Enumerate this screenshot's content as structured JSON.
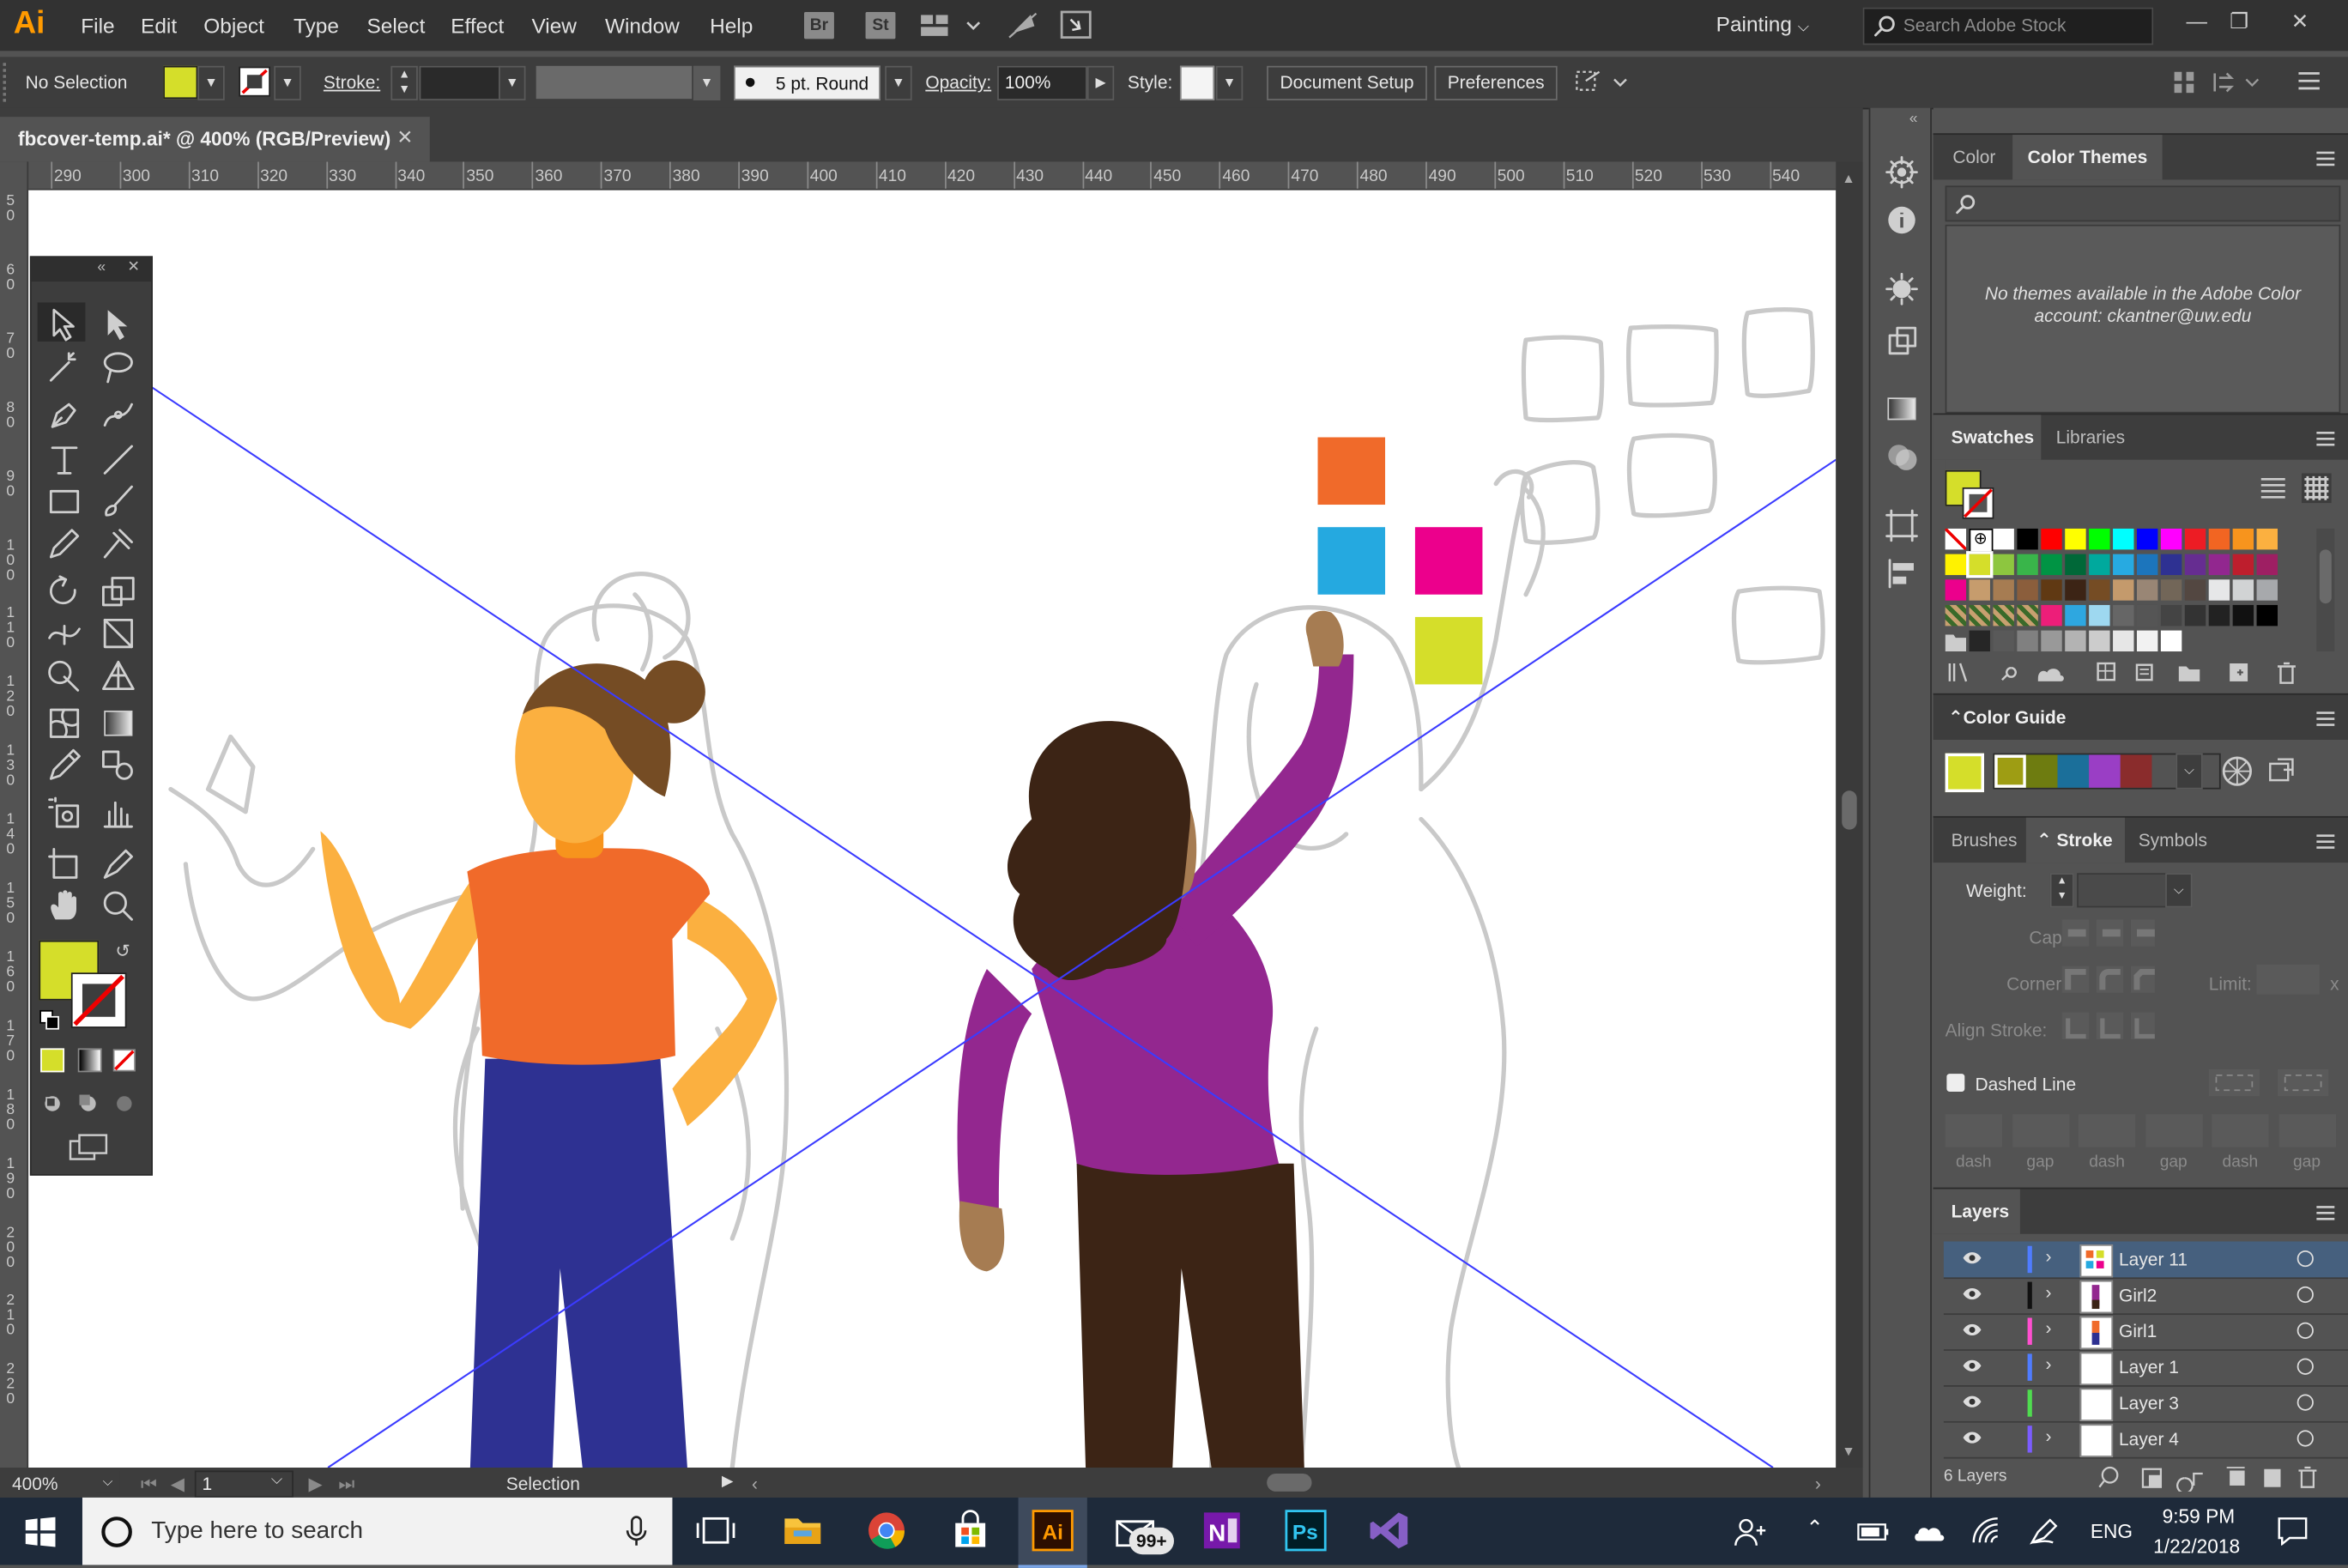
{
  "app": {
    "logo": "Ai",
    "menu": [
      "File",
      "Edit",
      "Object",
      "Type",
      "Select",
      "Effect",
      "View",
      "Window",
      "Help"
    ],
    "bridge_label": "Br",
    "stock_label": "St",
    "workspace": "Painting",
    "search_placeholder": "Search Adobe Stock"
  },
  "control": {
    "selection": "No Selection",
    "stroke_label": "Stroke:",
    "brush": "5 pt. Round",
    "opacity_label": "Opacity:",
    "opacity_value": "100%",
    "style_label": "Style:",
    "document_setup": "Document Setup",
    "preferences": "Preferences"
  },
  "document": {
    "tab_title": "fbcover-temp.ai* @ 400% (RGB/Preview)",
    "close": "✕"
  },
  "rulers": {
    "h_ticks": [
      "290",
      "300",
      "310",
      "320",
      "330",
      "340",
      "350",
      "360",
      "370",
      "380",
      "390",
      "400",
      "410",
      "420",
      "430",
      "440",
      "450",
      "460",
      "470",
      "480",
      "490",
      "500",
      "510",
      "520",
      "530",
      "540"
    ],
    "v_ticks": [
      "50",
      "60",
      "70",
      "80",
      "90",
      "100",
      "110",
      "120",
      "130",
      "140",
      "150",
      "160",
      "170",
      "180",
      "190",
      "200",
      "210",
      "220"
    ]
  },
  "status": {
    "zoom": "400%",
    "artboard": "1",
    "tool": "Selection"
  },
  "colors": {
    "fill": "#d5de2a",
    "orange": "#f06a2a",
    "blue": "#25a9e0",
    "magenta": "#ec008c",
    "yellowgreen": "#d5de2a",
    "purple": "#93278f",
    "navy": "#2e3192",
    "skin_light": "#fbb040",
    "hair_brown": "#754c24",
    "skin_dark": "#a67c52",
    "hair_dark": "#3c2415",
    "guide_blue": "#3b3bff"
  },
  "panels": {
    "color_tab": "Color",
    "color_themes_tab": "Color Themes",
    "themes_message": "No themes available in the Adobe Color account: ckantner@uw.edu",
    "swatches_tab": "Swatches",
    "libraries_tab": "Libraries",
    "color_guide_title": "Color Guide",
    "brushes_tab": "Brushes",
    "stroke_tab": "Stroke",
    "symbols_tab": "Symbols",
    "weight_label": "Weight:",
    "cap_label": "Cap:",
    "corner_label": "Corner:",
    "limit_label": "Limit:",
    "limit_x": "x",
    "align_label": "Align Stroke:",
    "dashed_label": "Dashed Line",
    "dash_labels": [
      "dash",
      "gap",
      "dash",
      "gap",
      "dash",
      "gap"
    ],
    "layers_title": "Layers",
    "layers": [
      {
        "name": "Layer 11",
        "color": "#4f7cff",
        "expand": "›",
        "selected": true
      },
      {
        "name": "Girl2",
        "color": "#111111",
        "expand": "›",
        "selected": false
      },
      {
        "name": "Girl1",
        "color": "#ff4fd0",
        "expand": "›",
        "selected": false
      },
      {
        "name": "Layer 1",
        "color": "#4f7cff",
        "expand": "›",
        "selected": false
      },
      {
        "name": "Layer 3",
        "color": "#4fdc4f",
        "expand": "",
        "selected": false
      },
      {
        "name": "Layer 4",
        "color": "#7b5cff",
        "expand": "›",
        "selected": false
      }
    ],
    "layers_count": "6 Layers"
  },
  "taskbar": {
    "search_placeholder": "Type here to search",
    "badge": "99+",
    "time": "9:59 PM",
    "date": "1/22/2018",
    "lang": "ENG"
  }
}
